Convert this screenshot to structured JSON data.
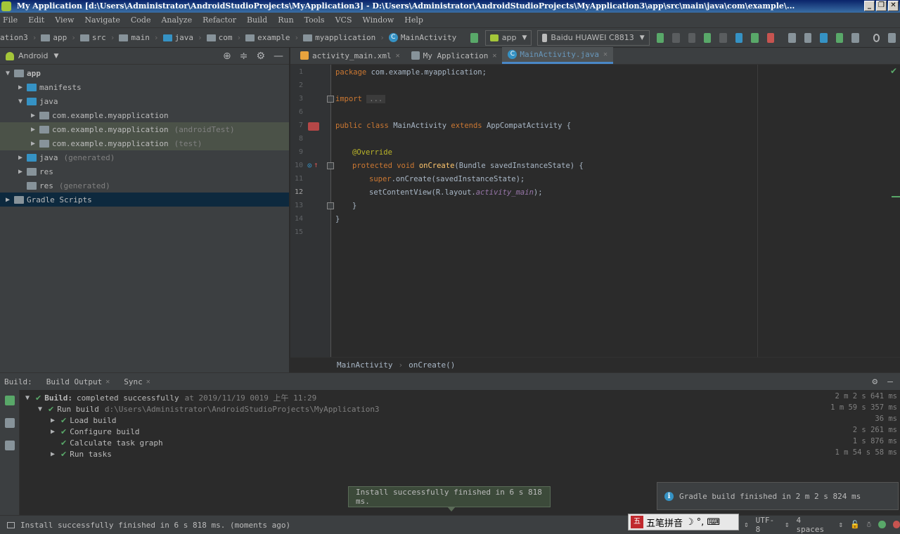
{
  "window": {
    "title": "My Application [d:\\Users\\Administrator\\AndroidStudioProjects\\MyApplication3] - D:\\Users\\Administrator\\AndroidStudioProjects\\MyApplication3\\app\\src\\main\\java\\com\\example\\...",
    "controls": [
      "_",
      "❐",
      "✕"
    ]
  },
  "menu": [
    "File",
    "Edit",
    "View",
    "Navigate",
    "Code",
    "Analyze",
    "Refactor",
    "Build",
    "Run",
    "Tools",
    "VCS",
    "Window",
    "Help"
  ],
  "navbar": {
    "crumbs": [
      "ation3",
      "app",
      "src",
      "main",
      "java",
      "com",
      "example",
      "myapplication",
      "MainActivity"
    ],
    "run_config": "app",
    "device": "Baidu HUAWEI C8813"
  },
  "project": {
    "view": "Android",
    "tree": [
      {
        "label": "app",
        "suffix": "",
        "indent": 0,
        "expander": "▼",
        "icon": "folder",
        "state": ""
      },
      {
        "label": "manifests",
        "suffix": "",
        "indent": 1,
        "expander": "▶",
        "icon": "folder-blue",
        "state": ""
      },
      {
        "label": "java",
        "suffix": "",
        "indent": 1,
        "expander": "▼",
        "icon": "folder-blue",
        "state": ""
      },
      {
        "label": "com.example.myapplication",
        "suffix": "",
        "indent": 2,
        "expander": "▶",
        "icon": "package",
        "state": ""
      },
      {
        "label": "com.example.myapplication",
        "suffix": "(androidTest)",
        "indent": 2,
        "expander": "▶",
        "icon": "package",
        "state": "sel"
      },
      {
        "label": "com.example.myapplication",
        "suffix": "(test)",
        "indent": 2,
        "expander": "▶",
        "icon": "package",
        "state": "sel"
      },
      {
        "label": "java",
        "suffix": "(generated)",
        "indent": 1,
        "expander": "▶",
        "icon": "folder-gen",
        "state": ""
      },
      {
        "label": "res",
        "suffix": "",
        "indent": 1,
        "expander": "▶",
        "icon": "folder-res",
        "state": ""
      },
      {
        "label": "res",
        "suffix": "(generated)",
        "indent": 1,
        "expander": "",
        "icon": "folder-res",
        "state": ""
      },
      {
        "label": "Gradle Scripts",
        "suffix": "",
        "indent": 0,
        "expander": "▶",
        "icon": "gradle",
        "state": "hl"
      }
    ]
  },
  "editor": {
    "tabs": [
      {
        "label": "activity_main.xml",
        "active": false
      },
      {
        "label": "My Application",
        "active": false
      },
      {
        "label": "MainActivity.java",
        "active": true
      }
    ],
    "line_numbers": [
      "1",
      "2",
      "3",
      "6",
      "7",
      "8",
      "9",
      "10",
      "11",
      "12",
      "13",
      "14",
      "15"
    ],
    "breadcrumb": [
      "MainActivity",
      "onCreate()"
    ]
  },
  "build": {
    "header_label": "Build:",
    "tabs": [
      "Build Output",
      "Sync"
    ],
    "rows": [
      {
        "indent": 0,
        "expander": "▼",
        "bold": "Build:",
        "text": "completed successfully",
        "muted": "at 2019/11/19 0019 上午 11:29",
        "time": "2 m 2 s 641 ms"
      },
      {
        "indent": 1,
        "expander": "▼",
        "bold": "",
        "text": "Run build",
        "muted": "d:\\Users\\Administrator\\AndroidStudioProjects\\MyApplication3",
        "time": "1 m 59 s 357 ms"
      },
      {
        "indent": 2,
        "expander": "▶",
        "bold": "",
        "text": "Load build",
        "muted": "",
        "time": "36 ms"
      },
      {
        "indent": 2,
        "expander": "▶",
        "bold": "",
        "text": "Configure build",
        "muted": "",
        "time": "2 s 261 ms"
      },
      {
        "indent": 2,
        "expander": "",
        "bold": "",
        "text": "Calculate task graph",
        "muted": "",
        "time": "1 s 876 ms"
      },
      {
        "indent": 2,
        "expander": "▶",
        "bold": "",
        "text": "Run tasks",
        "muted": "",
        "time": "1 m 54 s 58 ms"
      }
    ]
  },
  "toast": "Install successfully finished in 6 s 818 ms.",
  "balloon": "Gradle build finished in 2 m 2 s 824 ms",
  "status": {
    "message": "Install successfully finished in 6 s 818 ms. (moments ago)",
    "encoding": "UTF-8",
    "indent": "4 spaces",
    "ime_text": "五笔拼音"
  },
  "colors": {
    "accent": "#4a88c7",
    "success": "#59a869",
    "keyword": "#cc7832",
    "annotation": "#bbb529"
  }
}
